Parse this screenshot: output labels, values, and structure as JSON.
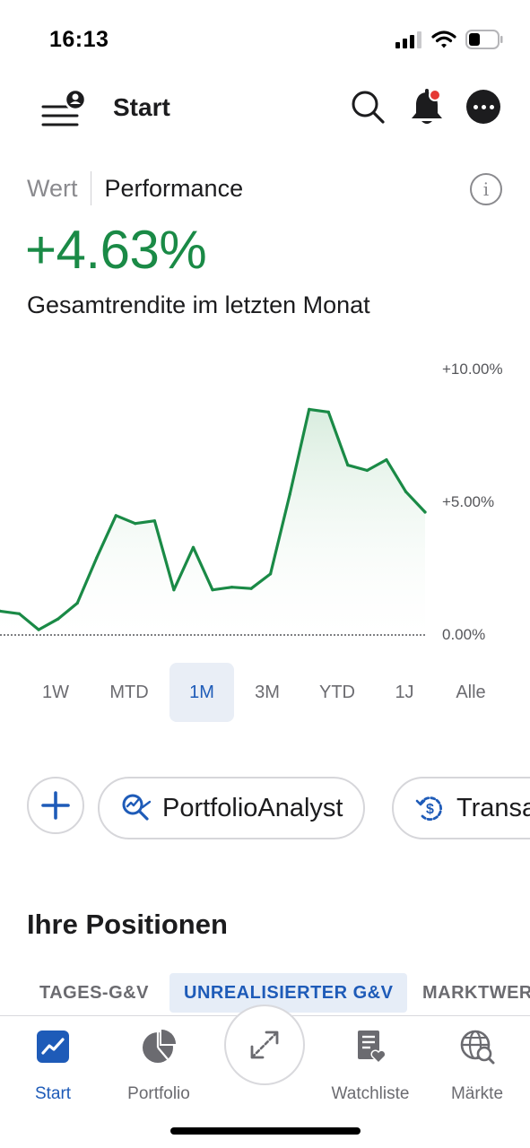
{
  "status": {
    "time": "16:13"
  },
  "nav": {
    "title": "Start"
  },
  "toggle": {
    "left": "Wert",
    "right": "Performance",
    "info": "i"
  },
  "performance": {
    "value": "+4.63%",
    "subtitle": "Gesamtrendite im letzten Monat"
  },
  "chart_data": {
    "type": "area",
    "y_tick_labels": [
      "+10.00%",
      "+5.00%",
      "0.00%"
    ],
    "ylim": [
      0,
      10
    ],
    "baseline_line": "dotted",
    "values": [
      0.9,
      0.8,
      0.2,
      0.6,
      1.2,
      2.9,
      4.5,
      4.2,
      4.3,
      1.7,
      3.3,
      1.7,
      1.8,
      1.75,
      2.3,
      5.3,
      8.5,
      8.4,
      6.4,
      6.2,
      6.6,
      5.4,
      4.63
    ],
    "color": "#1a8a46",
    "fill_color": "#e3f1e7"
  },
  "ranges": [
    {
      "label": "1W",
      "active": false
    },
    {
      "label": "MTD",
      "active": false
    },
    {
      "label": "1M",
      "active": true
    },
    {
      "label": "3M",
      "active": false
    },
    {
      "label": "YTD",
      "active": false
    },
    {
      "label": "1J",
      "active": false
    },
    {
      "label": "Alle",
      "active": false
    }
  ],
  "actions": {
    "portfolio_analyst": "PortfolioAnalyst",
    "transactions": "Transa"
  },
  "positions": {
    "title": "Ihre Positionen",
    "tabs": [
      {
        "label": "TAGES-G&V",
        "active": false
      },
      {
        "label": "UNREALISIERTER G&V",
        "active": true
      },
      {
        "label": "MARKTWERT",
        "active": false
      }
    ]
  },
  "tabbar": {
    "items": [
      {
        "label": "Start",
        "active": true
      },
      {
        "label": "Portfolio",
        "active": false
      },
      {
        "label": "Watchliste",
        "active": false
      },
      {
        "label": "Märkte",
        "active": false
      }
    ]
  },
  "colors": {
    "accent": "#1e5bb8",
    "positive": "#1a8a46",
    "notification": "#e53935"
  },
  "icons": [
    "menu-profile-icon",
    "search-icon",
    "bell-icon",
    "more-icon",
    "info-icon",
    "plus-icon",
    "analyst-icon",
    "transactions-icon",
    "start-chart-icon",
    "portfolio-pie-icon",
    "expand-arrows-icon",
    "watchlist-icon",
    "markets-globe-icon"
  ]
}
